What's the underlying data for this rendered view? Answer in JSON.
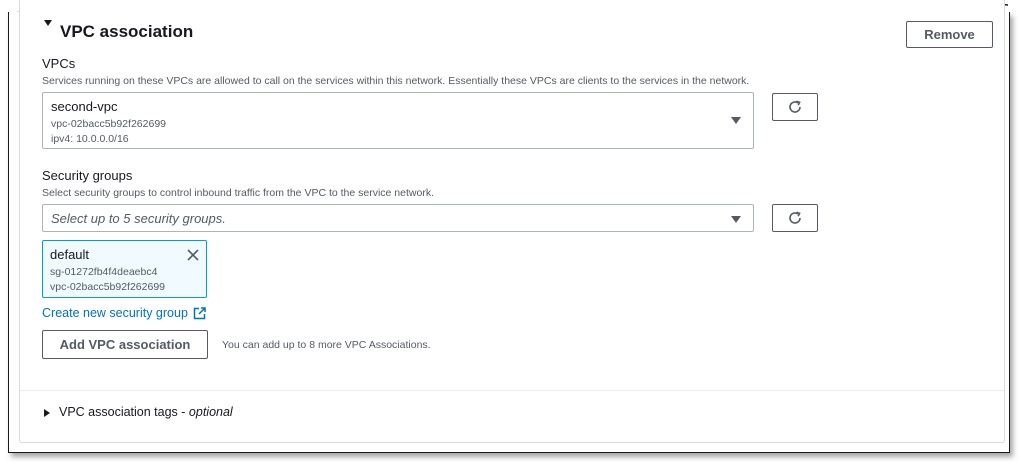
{
  "section": {
    "title": "VPC association",
    "remove_label": "Remove"
  },
  "vpcs": {
    "label": "VPCs",
    "description": "Services running on these VPCs are allowed to call on the services within this network. Essentially these VPCs are clients to the services in the network.",
    "selected_name": "second-vpc",
    "selected_id": "vpc-02bacc5b92f262699",
    "selected_cidr": "ipv4: 10.0.0.0/16"
  },
  "security_groups": {
    "label": "Security groups",
    "description": "Select security groups to control inbound traffic from the VPC to the service network.",
    "placeholder": "Select up to 5 security groups.",
    "tokens": [
      {
        "name": "default",
        "id": "sg-01272fb4f4deaebc4",
        "vpc": "vpc-02bacc5b92f262699"
      }
    ],
    "create_link": "Create new security group"
  },
  "association": {
    "add_label": "Add VPC association",
    "hint": "You can add up to 8 more VPC Associations."
  },
  "tags": {
    "label": "VPC association tags - ",
    "optional": "optional"
  },
  "icons": [
    "caret-down-icon",
    "refresh-icon",
    "close-icon",
    "external-link-icon",
    "caret-right-icon"
  ],
  "colors": {
    "link": "#0073bb",
    "token_border": "#00a1c9",
    "token_bg": "#f1faff",
    "button_border": "#545b64"
  }
}
